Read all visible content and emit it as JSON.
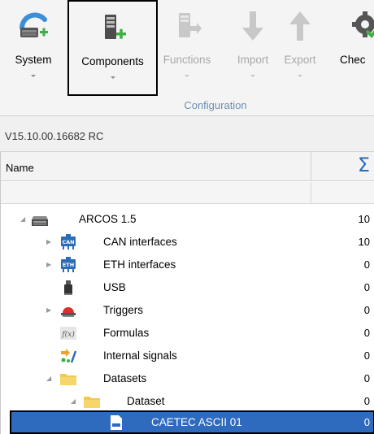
{
  "ribbon": {
    "buttons": [
      {
        "label": "System",
        "icon": "system-add-icon",
        "state": "normal"
      },
      {
        "label": "Components",
        "icon": "component-add-icon",
        "state": "selected"
      },
      {
        "label": "Functions",
        "icon": "function-arrow-icon",
        "state": "disabled"
      },
      {
        "label": "Import",
        "icon": "import-arrow-icon",
        "state": "disabled"
      },
      {
        "label": "Export",
        "icon": "export-arrow-icon",
        "state": "disabled"
      },
      {
        "label": "Chec",
        "icon": "check-gear-icon",
        "state": "normal"
      }
    ],
    "group_label": "Configuration"
  },
  "version": "V15.10.00.16682 RC",
  "grid": {
    "columns": {
      "name": "Name",
      "count_symbol": "Σ"
    },
    "rows": [
      {
        "label": "ARCOS 1.5",
        "count": "10",
        "icon": "device-icon",
        "expander": "expanded"
      },
      {
        "label": "CAN interfaces",
        "count": "10",
        "icon": "can-interface-icon",
        "expander": "collapsed"
      },
      {
        "label": "ETH interfaces",
        "count": "0",
        "icon": "eth-interface-icon",
        "expander": "collapsed"
      },
      {
        "label": "USB",
        "count": "0",
        "icon": "usb-icon",
        "expander": "none"
      },
      {
        "label": "Triggers",
        "count": "0",
        "icon": "trigger-icon",
        "expander": "collapsed"
      },
      {
        "label": "Formulas",
        "count": "0",
        "icon": "formula-icon",
        "expander": "none"
      },
      {
        "label": "Internal signals",
        "count": "0",
        "icon": "internal-signals-icon",
        "expander": "none"
      },
      {
        "label": "Datasets",
        "count": "0",
        "icon": "folder-icon",
        "expander": "expanded"
      },
      {
        "label": "Dataset",
        "count": "0",
        "icon": "folder-icon",
        "expander": "expanded"
      },
      {
        "label": "CAETEC ASCII 01",
        "count": "0",
        "icon": "caetec-file-icon",
        "expander": "none",
        "selected": true
      }
    ]
  },
  "colors": {
    "accent": "#2e6bbf",
    "green_plus": "#3cb043",
    "group_label": "#6d8fb0",
    "folder": "#f2c94c"
  }
}
